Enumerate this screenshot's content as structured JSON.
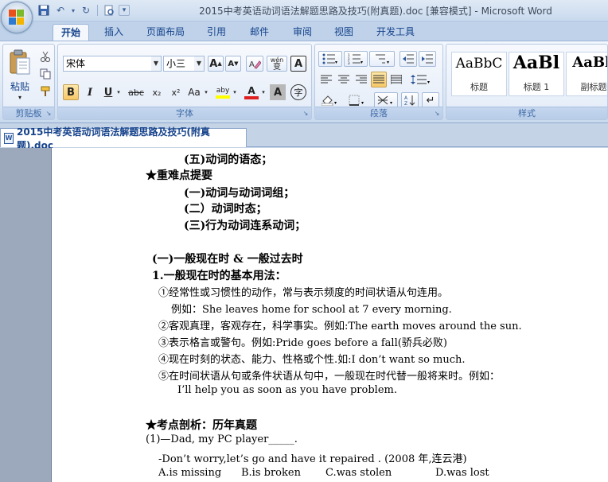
{
  "window": {
    "title": "2015中考英语动词语法解题思路及技巧(附真题).doc [兼容模式] - Microsoft Word"
  },
  "qat": {
    "save_icon": "save-icon",
    "undo_icon": "undo-icon",
    "redo_icon": "redo-icon"
  },
  "tabs": [
    {
      "label": "开始",
      "active": true
    },
    {
      "label": "插入"
    },
    {
      "label": "页面布局"
    },
    {
      "label": "引用"
    },
    {
      "label": "邮件"
    },
    {
      "label": "审阅"
    },
    {
      "label": "视图"
    },
    {
      "label": "开发工具"
    }
  ],
  "ribbon": {
    "clipboard": {
      "label": "剪贴板",
      "paste": "粘贴"
    },
    "font": {
      "label": "字体",
      "font_name": "宋体",
      "font_size": "小三",
      "grow_label": "A",
      "shrink_label": "A",
      "phonetic_label": "wén",
      "phonetic_char": "变",
      "border_label": "A",
      "bold": "B",
      "italic": "I",
      "underline": "U",
      "strike": "abc",
      "subscript": "x₂",
      "superscript": "x²",
      "change_case": "Aa",
      "highlight_label": "aby",
      "font_color_label": "A",
      "shade_label": "A",
      "enclose_label": "字"
    },
    "paragraph": {
      "label": "段落"
    },
    "styles": {
      "label": "样式",
      "items": [
        {
          "preview": "AaBbC",
          "name": "标题"
        },
        {
          "preview": "AaBl",
          "name": "标题 1"
        },
        {
          "preview": "AaBb",
          "name": "副标题"
        }
      ]
    }
  },
  "document_tab": {
    "label": "2015中考英语动词语法解题思路及技巧(附真题).doc"
  },
  "document": {
    "lines": [
      "(五)动词的语态；",
      "★重难点提要",
      "(一)动词与动词词组；",
      "(二）动词时态；",
      "(三)行为动词连系动词；",
      "(一)一般现在时 & 一般过去时",
      "1.一般现在时的基本用法：",
      "①经常性或习惯性的动作，常与表示频度的时间状语从句连用。",
      "例如：She leaves home for school at 7 every morning.",
      "②客观真理，客观存在，科学事实。例如:The earth moves around the sun.",
      "③表示格言或警句。例如:Pride goes before a fall(骄兵必败)",
      "④现在时刻的状态、能力、性格或个性.如:I don’t want so much.",
      "⑤在时间状语从句或条件状语从句中，一般现在时代替一般将来时。例如：",
      "I’ll help you as soon as you have problem.",
      "★考点剖析：历年真题",
      "(1)—Dad, my PC player_____.",
      "-Don’t worry,let’s go and have it repaired . (2008 年,连云港)",
      "A.is missing",
      "B.is broken",
      "C.was stolen",
      "D.was lost"
    ]
  }
}
